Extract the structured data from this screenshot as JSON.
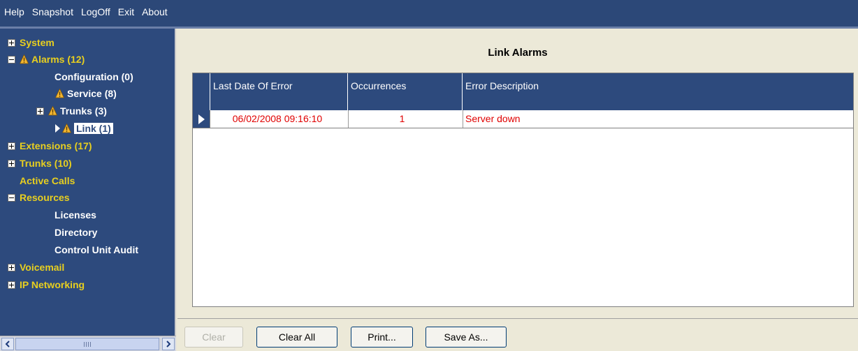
{
  "menu": [
    "Help",
    "Snapshot",
    "LogOff",
    "Exit",
    "About"
  ],
  "tree": {
    "system": "System",
    "alarms": "Alarms (12)",
    "configuration": "Configuration (0)",
    "service": "Service (8)",
    "alarm_trunks": "Trunks (3)",
    "link": "Link (1)",
    "extensions": "Extensions (17)",
    "trunks": "Trunks (10)",
    "active_calls": "Active Calls",
    "resources": "Resources",
    "licenses": "Licenses",
    "directory": "Directory",
    "control_unit_audit": "Control Unit Audit",
    "voicemail": "Voicemail",
    "ip_networking": "IP Networking"
  },
  "main": {
    "title": "Link Alarms",
    "columns": [
      "Last Date Of Error",
      "Occurrences",
      "Error Description"
    ],
    "rows": [
      {
        "date": "06/02/2008 09:16:10",
        "occurrences": "1",
        "description": "Server down"
      }
    ]
  },
  "buttons": {
    "clear": "Clear",
    "clear_all": "Clear All",
    "print": "Print...",
    "save_as": "Save As..."
  },
  "colors": {
    "panel_blue": "#2d4a7d",
    "tree_text_yellow": "#e8cf1f",
    "error_red": "#e00000",
    "warning_icon": "#f2b632"
  }
}
